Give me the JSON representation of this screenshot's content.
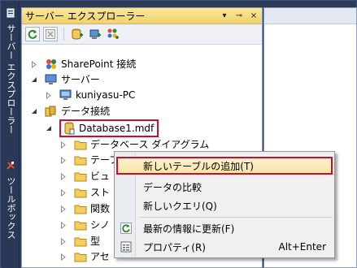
{
  "sidebar": {
    "tab1_label": "サーバー エクスプローラー",
    "tab2_label": "ツールボックス"
  },
  "window": {
    "title": "サーバー エクスプローラー",
    "dropdown_glyph": "▾",
    "pin_glyph": "⊸",
    "close_glyph": "×"
  },
  "tree": {
    "sharepoint": "SharePoint 接続",
    "servers": "サーバー",
    "machine": "kuniyasu-PC",
    "data_connections": "データ接続",
    "database": "Database1.mdf",
    "diagrams": "データベース ダイアグラム",
    "tables": "テーブル",
    "views": "ビュ",
    "stored": "スト",
    "functions": "関数",
    "synonyms": "シノ",
    "types": "型",
    "assemblies": "アセ"
  },
  "context_menu": {
    "add_table": "新しいテーブルの追加(T)",
    "compare": "データの比較",
    "new_query": "新しいクエリ(Q)",
    "refresh": "最新の情報に更新(F)",
    "properties": "プロパティ(R)",
    "properties_shortcut": "Alt+Enter"
  },
  "colors": {
    "highlight_border": "#c8102e",
    "title_gold": "#f2d16d",
    "strip_navy": "#293955"
  }
}
